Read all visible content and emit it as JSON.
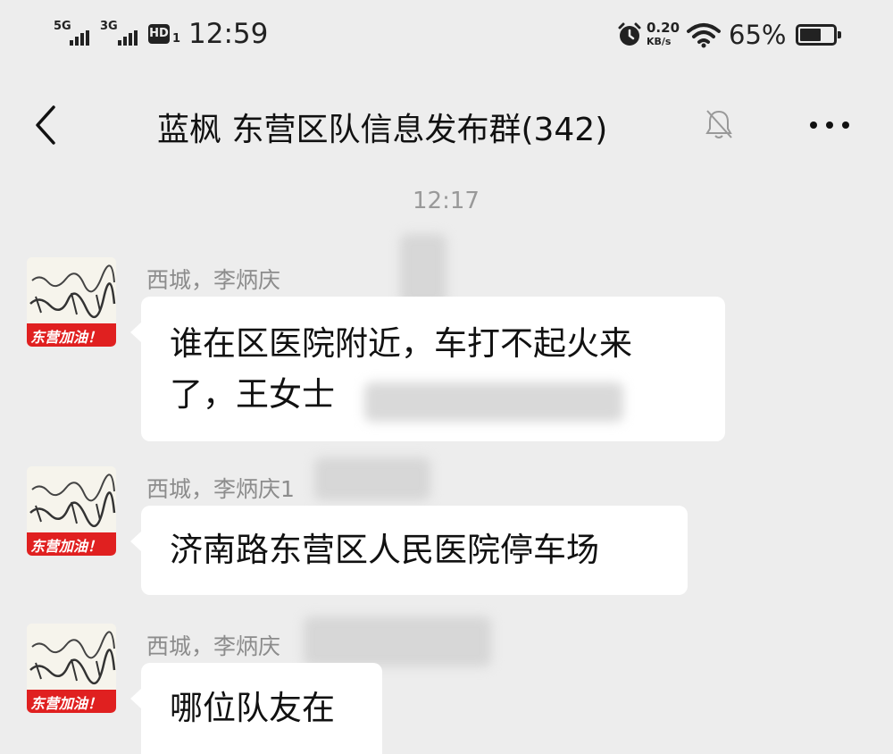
{
  "status_bar": {
    "net1": "5G",
    "net2": "3G",
    "hd": "HD",
    "sim": "1",
    "time": "12:59",
    "speed_value": "0.20",
    "speed_unit": "KB/s",
    "battery": "65%",
    "battery_level": 0.65
  },
  "header": {
    "back_icon": "chevron-left-icon",
    "title": "蓝枫 东营区队信息发布群(342)",
    "mute_icon": "bell-muted-icon",
    "more_icon": "more-dots-icon"
  },
  "chat": {
    "timestamp": "12:17",
    "avatar_badge": "东营加油！",
    "messages": [
      {
        "sender": "西城，李炳庆",
        "text_line1": "谁在区医院附近，车打不起火来",
        "text_line2": "了，王女士"
      },
      {
        "sender": "西城，李炳庆1",
        "text": "济南路东营区人民医院停车场"
      },
      {
        "sender": "西城，李炳庆",
        "text": "哪位队友在"
      }
    ]
  },
  "colors": {
    "background": "#ededed",
    "bubble": "#ffffff",
    "badge_red": "#e02020"
  }
}
